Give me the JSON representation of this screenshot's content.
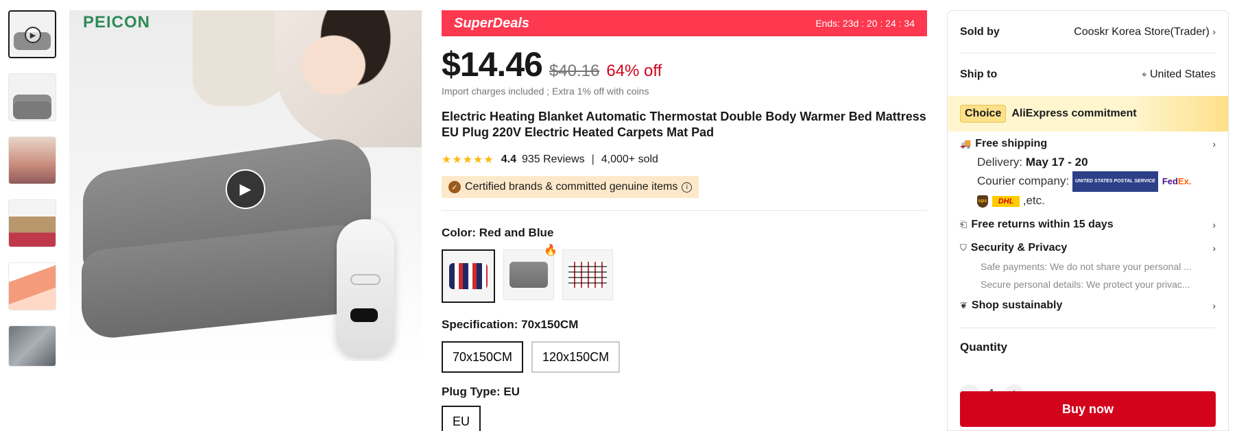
{
  "gallery": {
    "brand": "PEICON",
    "play_icon": "play-icon"
  },
  "superdeals": {
    "title": "SuperDeals",
    "timer": "Ends: 23d : 20 : 24 : 34"
  },
  "price": {
    "current": "$14.46",
    "original": "$40.16",
    "discount": "64% off",
    "note": "Import charges included ; Extra 1% off with coins"
  },
  "product": {
    "title": "Electric Heating Blanket Automatic Thermostat Double Body Warmer Bed Mattress EU Plug 220V Electric Heated Carpets Mat Pad"
  },
  "rating": {
    "stars": "★★★★★",
    "score": "4.4",
    "reviews": "935 Reviews",
    "sold": "4,000+ sold"
  },
  "cert": {
    "text": "Certified brands & committed genuine items"
  },
  "options": {
    "color_label": "Color: Red and Blue",
    "spec_label": "Specification: 70x150CM",
    "spec_values": [
      "70x150CM",
      "120x150CM"
    ],
    "plug_label": "Plug Type: EU",
    "plug_values": [
      "EU"
    ]
  },
  "sidebar": {
    "sold_by_label": "Sold by",
    "sold_by_value": "Cooskr Korea Store(Trader)",
    "ship_to_label": "Ship to",
    "ship_to_value": "United States",
    "choice_badge": "Choice",
    "choice_text": "AliExpress commitment",
    "free_shipping": "Free shipping",
    "delivery_label": "Delivery:",
    "delivery_value": "May 17 - 20",
    "courier_label": "Courier company:",
    "courier_etc": ",etc.",
    "courier_usps": "UNITED STATES POSTAL SERVICE",
    "courier_fedex_1": "Fed",
    "courier_fedex_2": "Ex.",
    "courier_ups": "ups",
    "courier_dhl": "DHL",
    "free_returns": "Free returns within 15 days",
    "security": "Security & Privacy",
    "security_line1": "Safe payments: We do not share your personal ...",
    "security_line2": "Secure personal details: We protect your privac...",
    "sustainably": "Shop sustainably",
    "quantity_label": "Quantity",
    "quantity_value": "1",
    "buy_now": "Buy now"
  },
  "colors": {
    "superdeals_bg": "#fd384f",
    "discount": "#d3031c",
    "buy_button": "#d3031c",
    "star": "#fdb914",
    "cert_bg": "#fde8c9",
    "choice_bg": "#fff6d0"
  }
}
